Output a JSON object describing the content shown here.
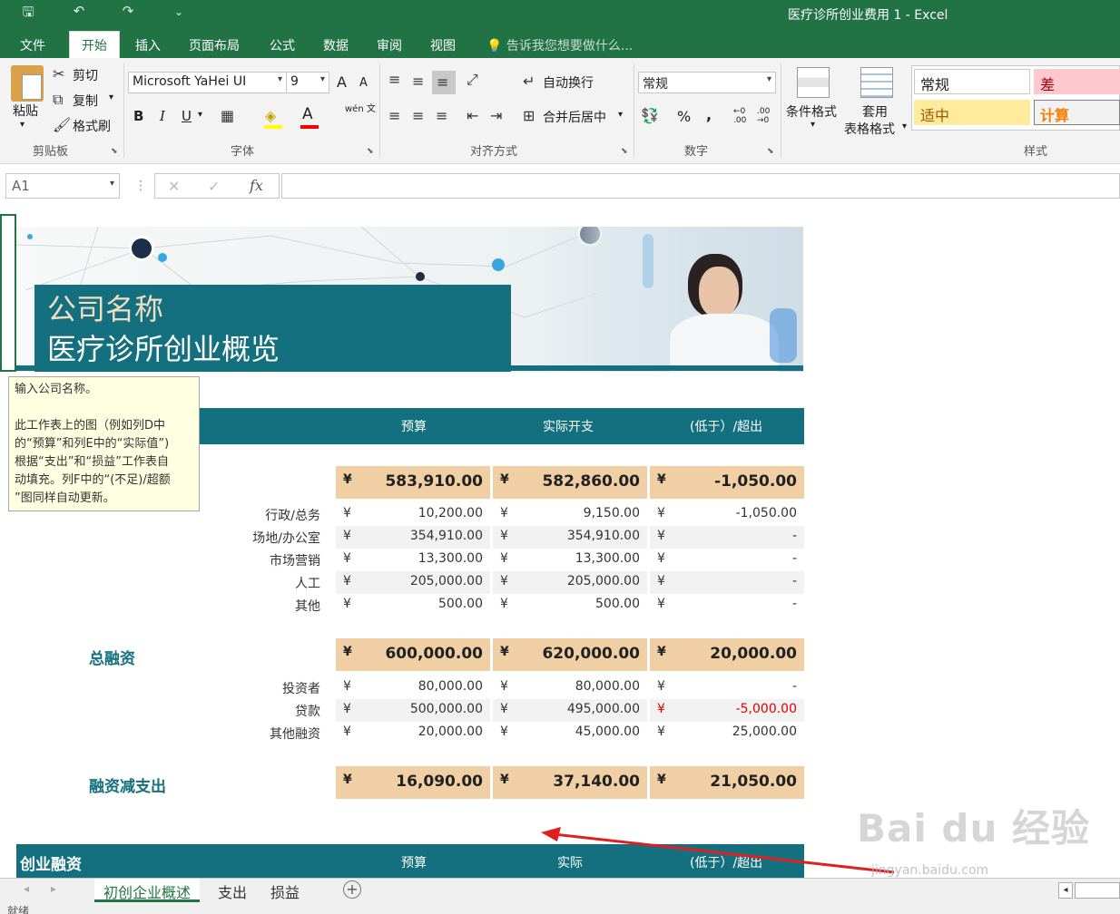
{
  "window": {
    "doc_title": "医疗诊所创业费用 1 - Excel"
  },
  "quick_access": {
    "save": "🖫",
    "undo": "↶",
    "redo": "↷",
    "customize": "⌄"
  },
  "menu": {
    "tabs": [
      "文件",
      "开始",
      "插入",
      "页面布局",
      "公式",
      "数据",
      "审阅",
      "视图"
    ],
    "active": "开始",
    "tell_me": "告诉我您想要做什么..."
  },
  "ribbon": {
    "clipboard": {
      "paste": "粘贴",
      "cut": "剪切",
      "copy": "复制",
      "format_painter": "格式刷",
      "label": "剪贴板"
    },
    "font": {
      "name": "Microsoft YaHei UI",
      "size": "9",
      "label": "字体",
      "bold": "B",
      "italic": "I",
      "underline": "U",
      "grow": "A",
      "shrink": "A",
      "wen": "wén 文"
    },
    "alignment": {
      "wrap": "自动换行",
      "merge": "合并后居中",
      "label": "对齐方式"
    },
    "number": {
      "format": "常规",
      "percent": "%",
      "comma": ",",
      "inc_decimal": ".00",
      "dec_decimal": ".00",
      "label": "数字"
    },
    "styles": {
      "conditional": "条件格式",
      "table_format_1": "套用",
      "table_format_2": "表格格式",
      "cells": [
        {
          "label": "常规",
          "bg": "#ffffff",
          "color": "#000000"
        },
        {
          "label": "差",
          "bg": "#ffc7ce",
          "color": "#9c0006"
        },
        {
          "label": "适中",
          "bg": "#ffeb9c",
          "color": "#9c5700"
        },
        {
          "label": "计算",
          "bg": "#f2f2f2",
          "color": "#fa7d00"
        }
      ],
      "label": "样式"
    }
  },
  "formula_bar": {
    "name_box": "A1",
    "fx": "fx",
    "cancel": "✕",
    "enter": "✓",
    "value": ""
  },
  "sheet": {
    "company": "公司名称",
    "title": "医疗诊所创业概览",
    "tooltip": [
      "输入公司名称。",
      "",
      "此工作表上的图（例如列D中",
      "的“预算”和列E中的“实际值”)",
      "根据“支出”和“损益”工作表自",
      "动填充。列F中的“(不足)/超额",
      "”图同样自动更新。"
    ],
    "header": {
      "budget": "预算",
      "actual": "实际开支",
      "variance": "(低于）/超出"
    },
    "currency": "¥",
    "expense_total": {
      "budget": "583,910.00",
      "actual": "582,860.00",
      "variance": "-1,050.00"
    },
    "expense_rows": [
      {
        "label": "行政/总务",
        "budget": "10,200.00",
        "actual": "9,150.00",
        "variance": "-1,050.00",
        "neg": false
      },
      {
        "label": "场地/办公室",
        "budget": "354,910.00",
        "actual": "354,910.00",
        "variance": "-",
        "neg": false
      },
      {
        "label": "市场营销",
        "budget": "13,300.00",
        "actual": "13,300.00",
        "variance": "-",
        "neg": false
      },
      {
        "label": "人工",
        "budget": "205,000.00",
        "actual": "205,000.00",
        "variance": "-",
        "neg": false
      },
      {
        "label": "其他",
        "budget": "500.00",
        "actual": "500.00",
        "variance": "-",
        "neg": false
      }
    ],
    "funding_label": "总融资",
    "funding_total": {
      "budget": "600,000.00",
      "actual": "620,000.00",
      "variance": "20,000.00"
    },
    "funding_rows": [
      {
        "label": "投资者",
        "budget": "80,000.00",
        "actual": "80,000.00",
        "variance": "-",
        "neg": false
      },
      {
        "label": "贷款",
        "budget": "500,000.00",
        "actual": "495,000.00",
        "variance": "-5,000.00",
        "neg": true
      },
      {
        "label": "其他融资",
        "budget": "20,000.00",
        "actual": "45,000.00",
        "variance": "25,000.00",
        "neg": false
      }
    ],
    "net_label": "融资减支出",
    "net_total": {
      "budget": "16,090.00",
      "actual": "37,140.00",
      "variance": "21,050.00"
    },
    "section2": {
      "title": "创业融资",
      "budget": "预算",
      "actual": "实际",
      "variance": "(低于）/超出"
    }
  },
  "sheet_tabs": [
    "初创企业概述",
    "支出",
    "损益"
  ],
  "status": "就绪",
  "watermark": {
    "main": "Bai du 经验",
    "sub": "jingyan.baidu.com"
  }
}
